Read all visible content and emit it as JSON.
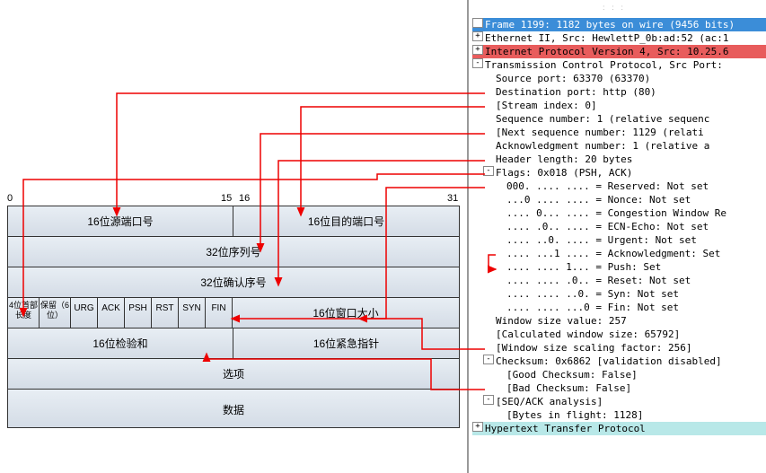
{
  "ruler": {
    "t0": "0",
    "t15": "15",
    "t16": "16",
    "t31": "31"
  },
  "header": {
    "src_port": "16位源端口号",
    "dst_port": "16位目的端口号",
    "seq": "32位序列号",
    "ack": "32位确认序号",
    "hlen": "4位首部长度",
    "reserved": "保留（6位）",
    "urg": "URG",
    "ackf": "ACK",
    "psh": "PSH",
    "rst": "RST",
    "syn": "SYN",
    "fin": "FIN",
    "win": "16位窗口大小",
    "cksum": "16位检验和",
    "urgptr": "16位紧急指针",
    "opts": "选项",
    "data": "数据"
  },
  "tree": {
    "frame": "Frame 1199: 1182 bytes on wire (9456 bits)",
    "eth": "Ethernet II, Src: HewlettP_0b:ad:52 (ac:1",
    "ip": "Internet Protocol Version 4, Src: 10.25.6",
    "tcp": "Transmission Control Protocol, Src Port: ",
    "srcport": "Source port: 63370 (63370)",
    "dstport": "Destination port: http (80)",
    "stream": "[Stream index: 0]",
    "seq": "Sequence number: 1    (relative sequenc",
    "nextseq": "[Next sequence number: 1129    (relati",
    "acknum": "Acknowledgment number: 1    (relative a",
    "hlen": "Header length: 20 bytes",
    "flags": "Flags: 0x018 (PSH, ACK)",
    "f_res": "000. .... .... = Reserved: Not set",
    "f_nonce": "...0 .... .... = Nonce: Not set",
    "f_cwr": ".... 0... .... = Congestion Window Re",
    "f_ecn": ".... .0.. .... = ECN-Echo: Not set",
    "f_urg": ".... ..0. .... = Urgent: Not set",
    "f_ack": ".... ...1 .... = Acknowledgment: Set",
    "f_psh": ".... .... 1... = Push: Set",
    "f_rst": ".... .... .0.. = Reset: Not set",
    "f_syn": ".... .... ..0. = Syn: Not set",
    "f_fin": ".... .... ...0 = Fin: Not set",
    "win": "Window size value: 257",
    "calcwin": "[Calculated window size: 65792]",
    "winscale": "[Window size scaling factor: 256]",
    "cksum": "Checksum: 0x6862 [validation disabled]",
    "goodck": "[Good Checksum: False]",
    "badck": "[Bad Checksum: False]",
    "seqack": "[SEQ/ACK analysis]",
    "bytes": "[Bytes in flight: 1128]",
    "http": "Hypertext Transfer Protocol"
  }
}
